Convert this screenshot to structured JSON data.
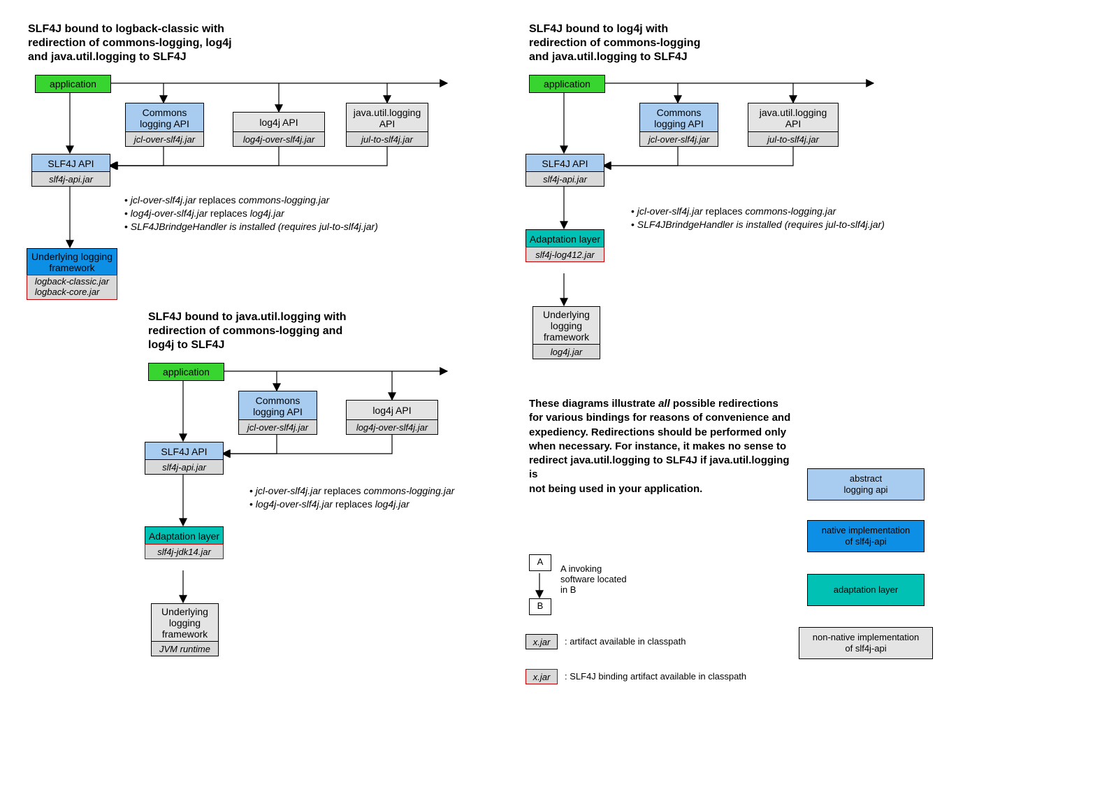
{
  "diag1": {
    "title": "SLF4J bound to logback-classic with\nredirection of commons-logging, log4j\nand java.util.logging to SLF4J",
    "app": "application",
    "commons": "Commons\nlogging API",
    "commons_jar": "jcl-over-slf4j.jar",
    "log4j": "log4j API",
    "log4j_jar": "log4j-over-slf4j.jar",
    "jul": "java.util.logging\nAPI",
    "jul_jar": "jul-to-slf4j.jar",
    "slf4j": "SLF4J API",
    "slf4j_jar": "slf4j-api.jar",
    "underlying": "Underlying logging\nframework",
    "underlying_jars": "logback-classic.jar\nlogback-core.jar",
    "bullet1_pre": "jcl-over-slf4j.jar",
    "bullet1_mid": " replaces ",
    "bullet1_suf": "commons-logging.jar",
    "bullet2_pre": "log4j-over-slf4j.jar",
    "bullet2_mid": " replaces ",
    "bullet2_suf": "log4j.jar",
    "bullet3_pre": "SLF4JBrindgeHandler",
    "bullet3_mid": " is installed (requires ",
    "bullet3_suf": "jul-to-slf4j.jar",
    "bullet3_end": ")"
  },
  "diag2": {
    "title": "SLF4J bound to java.util.logging with\nredirection of commons-logging and\nlog4j to SLF4J",
    "app": "application",
    "commons": "Commons\nlogging API",
    "commons_jar": "jcl-over-slf4j.jar",
    "log4j": "log4j API",
    "log4j_jar": "log4j-over-slf4j.jar",
    "slf4j": "SLF4J API",
    "slf4j_jar": "slf4j-api.jar",
    "adapt": "Adaptation layer",
    "adapt_jar": "slf4j-jdk14.jar",
    "underlying": "Underlying\nlogging\nframework",
    "underlying_jar": "JVM runtime",
    "bullet1_pre": "jcl-over-slf4j.jar",
    "bullet1_mid": " replaces ",
    "bullet1_suf": "commons-logging.jar",
    "bullet2_pre": "log4j-over-slf4j.jar",
    "bullet2_mid": " replaces ",
    "bullet2_suf": "log4j.jar"
  },
  "diag3": {
    "title": "SLF4J bound to log4j with\nredirection of commons-logging\nand java.util.logging to SLF4J",
    "app": "application",
    "commons": "Commons\nlogging API",
    "commons_jar": "jcl-over-slf4j.jar",
    "jul": "java.util.logging\nAPI",
    "jul_jar": "jul-to-slf4j.jar",
    "slf4j": "SLF4J API",
    "slf4j_jar": "slf4j-api.jar",
    "adapt": "Adaptation layer",
    "adapt_jar": "slf4j-log412.jar",
    "underlying": "Underlying\nlogging\nframework",
    "underlying_jar": "log4j.jar",
    "bullet1_pre": "jcl-over-slf4j.jar",
    "bullet1_mid": " replaces ",
    "bullet1_suf": "commons-logging.jar",
    "bullet3_pre": "SLF4JBrindgeHandler",
    "bullet3_mid": " is installed (requires ",
    "bullet3_suf": "jul-to-slf4j.jar",
    "bullet3_end": ")"
  },
  "note_pre": "These diagrams illustrate ",
  "note_em": "all",
  "note_post": " possible redirections for various bindings for reasons of convenience and expediency. Redirections should be performed only when necessary. For instance, it makes no sense to redirect java.util.logging to SLF4J if java.util.logging is\nnot being used in your application.",
  "legend": {
    "a": "A",
    "b": "B",
    "ab_text": "A invoking\nsoftware located\nin B",
    "xjar": "x.jar",
    "xjar_text": ": artifact available in classpath",
    "xjar2_text": ": SLF4J binding artifact available in classpath",
    "abstract": "abstract\nlogging api",
    "native": "native implementation\nof slf4j-api",
    "adapt": "adaptation layer",
    "nonnative": "non-native implementation\nof slf4j-api"
  }
}
